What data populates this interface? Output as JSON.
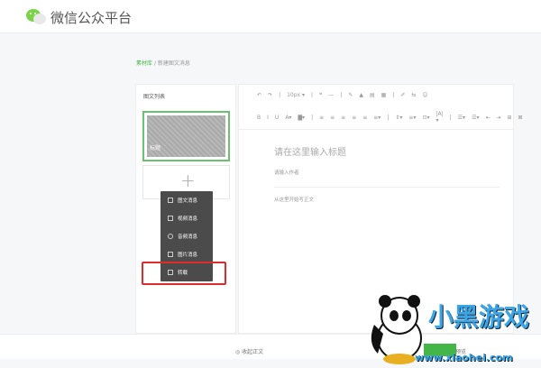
{
  "header": {
    "title": "微信公众平台"
  },
  "breadcrumb": {
    "root": "素材库",
    "sep": "/",
    "current": "新建图文消息"
  },
  "left": {
    "title": "图文列表",
    "cover_label": "标题",
    "add": "+"
  },
  "menu": [
    {
      "label": "图文消息",
      "icon": "article-icon"
    },
    {
      "label": "视频消息",
      "icon": "video-icon"
    },
    {
      "label": "音频消息",
      "icon": "mic-icon"
    },
    {
      "label": "图片消息",
      "icon": "image-icon"
    },
    {
      "label": "转载",
      "icon": "repost-icon"
    }
  ],
  "toolbar": {
    "row1": [
      "↶",
      "↷",
      "|",
      "10px ▾",
      "|",
      "❝",
      "—",
      "|",
      "✎",
      "▲",
      "▤",
      "▦",
      "|",
      "✐",
      "⇆",
      "☺"
    ],
    "row2": [
      "B",
      "I",
      "U",
      "A▾",
      "▇▾",
      "|",
      "≡",
      "≡",
      "≡",
      "≡",
      "≡",
      "≡▾",
      "|",
      "⇕▾",
      "≡▾",
      "⊡▾",
      "|A|▾",
      "|",
      "☰▾",
      "☰▾",
      "⇤",
      "⇥",
      "⊞",
      "⊠"
    ]
  },
  "editor": {
    "title_placeholder": "请在这里输入标题",
    "author_placeholder": "请输入作者",
    "body_placeholder": "从这里开始写正文"
  },
  "footer": {
    "collapse": "◎ 收起正文",
    "preview": "预览"
  },
  "watermark": {
    "text": "小黑游戏",
    "url": "www.xiaohei.com"
  },
  "colors": {
    "accent": "#44b549",
    "highlight": "#e02b2b",
    "menu_bg": "#4b4b4b"
  }
}
